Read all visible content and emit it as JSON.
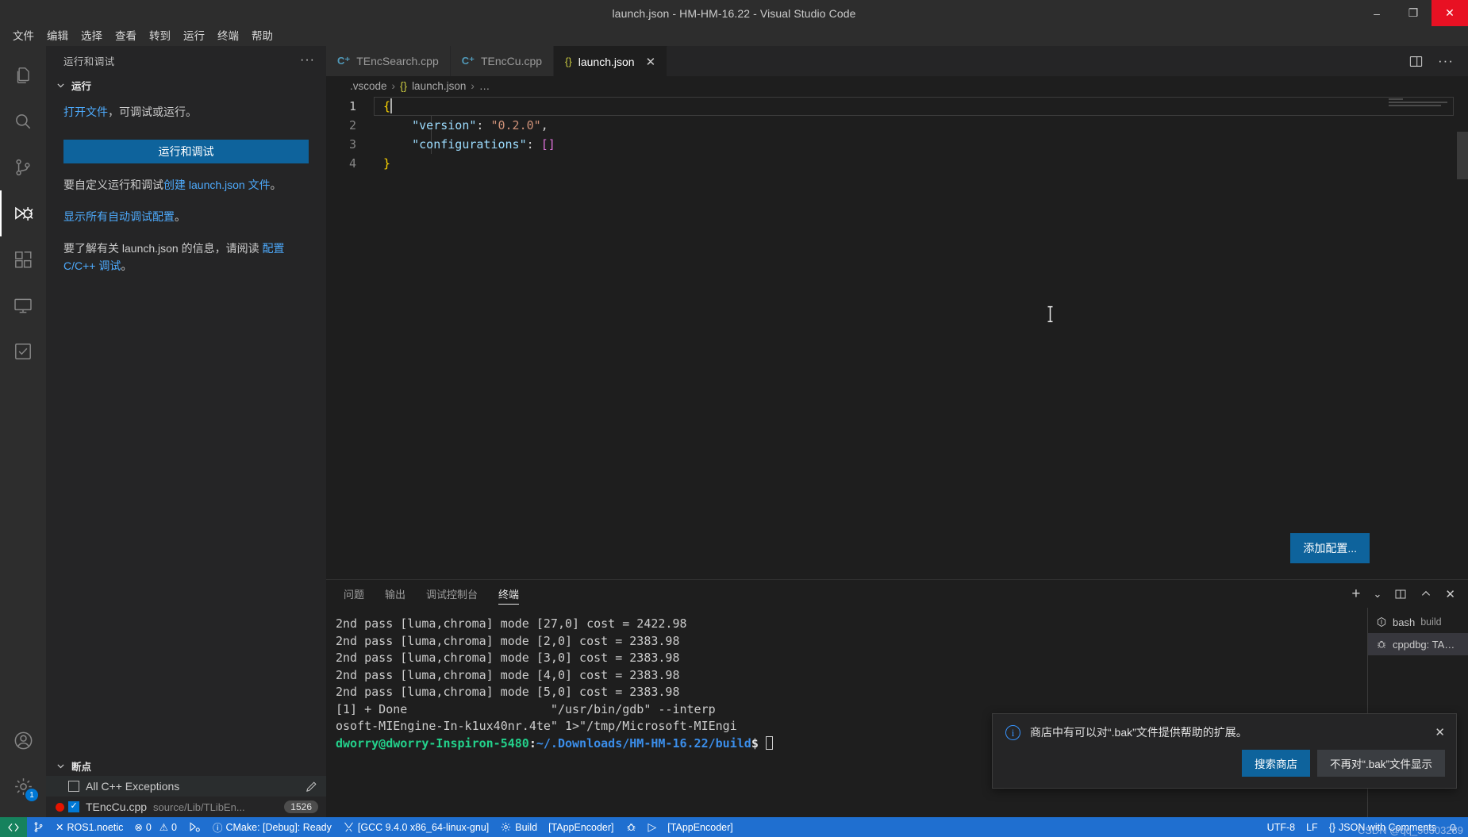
{
  "window": {
    "title": "launch.json - HM-HM-16.22 - Visual Studio Code",
    "minimize": "–",
    "maximize": "❐",
    "close": "✕"
  },
  "menubar": {
    "items": [
      "文件",
      "编辑",
      "选择",
      "查看",
      "转到",
      "运行",
      "终端",
      "帮助"
    ]
  },
  "activitybar": {
    "items": [
      {
        "name": "explorer-icon",
        "label": "资源管理器"
      },
      {
        "name": "search-icon",
        "label": "搜索"
      },
      {
        "name": "source-control-icon",
        "label": "源代码管理"
      },
      {
        "name": "run-debug-icon",
        "label": "运行和调试"
      },
      {
        "name": "extensions-icon",
        "label": "扩展"
      },
      {
        "name": "remote-explorer-icon",
        "label": "远程资源管理器"
      },
      {
        "name": "testing-icon",
        "label": "测试"
      }
    ],
    "bottom": [
      {
        "name": "account-icon",
        "label": "帐户"
      },
      {
        "name": "settings-gear-icon",
        "label": "管理",
        "badge": "1"
      }
    ]
  },
  "sidebar": {
    "title": "运行和调试",
    "more_actions": "···",
    "section_run": {
      "title": "运行",
      "line1_link": "打开文件",
      "line1_rest": "，可调试或运行。",
      "run_button": "运行和调试",
      "line2_prefix": "要自定义运行和调试",
      "line2_link": "创建 launch.json 文件",
      "line2_suffix": "。",
      "line3_link": "显示所有自动调试配置",
      "line3_suffix": "。",
      "line4_prefix": "要了解有关 launch.json 的信息，请阅读 ",
      "line4_link": "配置 C/C++ 调试",
      "line4_suffix": "。"
    },
    "section_breakpoints": {
      "title": "断点",
      "rows": [
        {
          "label": "All C++ Exceptions",
          "checked": false,
          "has_breakpoint_dot": false,
          "action_icon": "pencil-icon",
          "sub": "",
          "badge": ""
        },
        {
          "label": "TEncCu.cpp",
          "checked": true,
          "has_breakpoint_dot": true,
          "action_icon": "",
          "sub": "source/Lib/TLibEn...",
          "badge": "1526"
        }
      ]
    }
  },
  "editor": {
    "tabs": [
      {
        "label": "TEncSearch.cpp",
        "icon": "cpp-file-icon",
        "icon_glyph": "C⁺",
        "active": false,
        "closable": false
      },
      {
        "label": "TEncCu.cpp",
        "icon": "cpp-file-icon",
        "icon_glyph": "C⁺",
        "active": false,
        "closable": false
      },
      {
        "label": "launch.json",
        "icon": "json-file-icon",
        "icon_glyph": "{}",
        "active": true,
        "closable": true
      }
    ],
    "tab_close": "✕",
    "actions": {
      "split_editor": "split-editor-icon",
      "more": "···"
    },
    "breadcrumb": {
      "folder": ".vscode",
      "sep": "›",
      "file_icon": "{}",
      "file": "launch.json",
      "tail": "…"
    },
    "line_numbers": [
      "1",
      "2",
      "3",
      "4"
    ],
    "lines": [
      {
        "n": "1",
        "text": "{"
      },
      {
        "n": "2",
        "text": "    \"version\": \"0.2.0\","
      },
      {
        "n": "3",
        "text": "    \"configurations\": []"
      },
      {
        "n": "4",
        "text": "}"
      }
    ],
    "code": {
      "l2_key": "\"version\"",
      "l2_colon": ": ",
      "l2_val": "\"0.2.0\"",
      "l2_comma": ",",
      "l3_key": "\"configurations\"",
      "l3_colon": ": ",
      "l3_val": "[]",
      "open_brace": "{",
      "close_brace": "}"
    },
    "add_config_button": "添加配置..."
  },
  "panel": {
    "tabs": [
      {
        "label": "问题",
        "active": false
      },
      {
        "label": "输出",
        "active": false
      },
      {
        "label": "调试控制台",
        "active": false
      },
      {
        "label": "终端",
        "active": true
      }
    ],
    "actions": {
      "new_terminal": "+",
      "dropdown": "⌄",
      "split": "split-terminal-icon",
      "maximize": "⌃",
      "close": "✕"
    },
    "terminal_lines": [
      "2nd pass [luma,chroma] mode [27,0] cost = 2422.98",
      "2nd pass [luma,chroma] mode [2,0] cost = 2383.98",
      "2nd pass [luma,chroma] mode [3,0] cost = 2383.98",
      "2nd pass [luma,chroma] mode [4,0] cost = 2383.98",
      "2nd pass [luma,chroma] mode [5,0] cost = 2383.98",
      "[1] + Done                    \"/usr/bin/gdb\" --interp",
      "osoft-MIEngine-In-k1ux40nr.4te\" 1>\"/tmp/Microsoft-MIEngi"
    ],
    "prompt": {
      "user_host": "dworry@dworry-Inspiron-5480",
      "colon": ":",
      "path": "~/.Downloads/HM-HM-16.22/build",
      "symbol": "$"
    },
    "terminal_list": [
      {
        "name": "bash",
        "sub": "build",
        "icon": "terminal-bash-icon",
        "active": false
      },
      {
        "name": "cppdbg: TA…",
        "sub": "",
        "icon": "debug-bug-icon",
        "active": true
      }
    ]
  },
  "notification": {
    "icon": "info-icon",
    "message": "商店中有可以对“.bak”文件提供帮助的扩展。",
    "close": "✕",
    "primary_button": "搜索商店",
    "secondary_button": "不再对“.bak”文件显示"
  },
  "statusbar": {
    "remote": "⌨",
    "left": [
      {
        "name": "source-control-branch",
        "icon": "branch-icon",
        "text": ""
      },
      {
        "name": "ros-status",
        "icon": "✕",
        "text": "ROS1.noetic"
      },
      {
        "name": "problems",
        "icon": "⊗",
        "text": "0"
      },
      {
        "name": "warnings",
        "icon": "⚠",
        "text": "0"
      },
      {
        "name": "debug-config",
        "icon": "debug-alt-icon",
        "text": ""
      },
      {
        "name": "cmake-status",
        "icon": "ⓘ",
        "text": "CMake: [Debug]: Ready"
      },
      {
        "name": "cmake-kit",
        "icon": "tools-icon",
        "text": "[GCC 9.4.0 x86_64-linux-gnu]"
      },
      {
        "name": "cmake-build",
        "icon": "gear-icon",
        "text": "Build"
      },
      {
        "name": "cmake-build-target",
        "icon": "",
        "text": "[TAppEncoder]"
      },
      {
        "name": "cmake-debug",
        "icon": "bug-icon",
        "text": ""
      },
      {
        "name": "cmake-launch",
        "icon": "▷",
        "text": ""
      },
      {
        "name": "cmake-launch-target",
        "icon": "",
        "text": "[TAppEncoder]"
      }
    ],
    "right": [
      {
        "name": "encoding",
        "text": "UTF-8"
      },
      {
        "name": "eol",
        "text": "LF"
      },
      {
        "name": "language-mode",
        "icon": "{}",
        "text": "JSON with Comments"
      },
      {
        "name": "notifications-bell",
        "icon": "🔔",
        "text": ""
      }
    ],
    "watermark": "CSDN @qq_56303289"
  }
}
